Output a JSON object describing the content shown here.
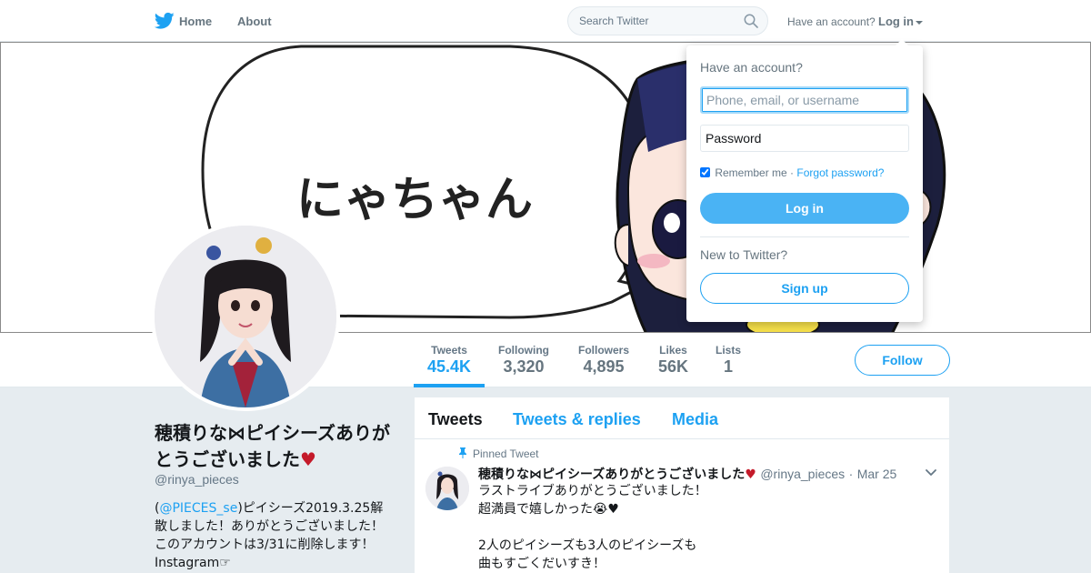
{
  "topnav": {
    "home_label": "Home",
    "about_label": "About",
    "search_placeholder": "Search Twitter",
    "have_account_text": "Have an account?",
    "login_label": "Log in"
  },
  "banner": {
    "speech_text": "にゃちゃん"
  },
  "profile_nav": {
    "stats": [
      {
        "label": "Tweets",
        "value": "45.4K"
      },
      {
        "label": "Following",
        "value": "3,320"
      },
      {
        "label": "Followers",
        "value": "4,895"
      },
      {
        "label": "Likes",
        "value": "56K"
      },
      {
        "label": "Lists",
        "value": "1"
      }
    ],
    "active_stat": "Tweets",
    "follow_label": "Follow"
  },
  "profile": {
    "name": "穂積りな⋈ピイシーズありがとうございました",
    "heart": "♥",
    "handle": "@rinya_pieces",
    "bio_prefix": "(",
    "bio_mention": "@PIECES_se",
    "bio_rest": ")ピイシーズ2019.3.25解散しました！ありがとうございました！このアカウントは3/31に削除します！ Instagram☞"
  },
  "timeline": {
    "tabs": [
      "Tweets",
      "Tweets & replies",
      "Media"
    ],
    "active_tab": "Tweets",
    "pinned_label": "Pinned Tweet",
    "tweet": {
      "name": "穂積りな⋈ピイシーズありがとうございました",
      "heart": "♥",
      "handle": "@rinya_pieces",
      "date_sep": "·",
      "date": "Mar 25",
      "lines": [
        "ラストライブありがとうございました！",
        "超満員で嬉しかった😭♥",
        "",
        "2人のピイシーズも3人のピイシーズも",
        "曲もすごくだいすき！"
      ]
    }
  },
  "login_dropdown": {
    "title": "Have an account?",
    "username_placeholder": "Phone, email, or username",
    "password_placeholder": "Password",
    "remember_label": "Remember me",
    "remember_sep": "·",
    "forgot_label": "Forgot password?",
    "login_button": "Log in",
    "new_to_twitter": "New to Twitter?",
    "signup_button": "Sign up"
  },
  "colors": {
    "brand_blue": "#1da1f2",
    "login_button_bg": "#4ab3f4",
    "heart_red": "#c41a2a",
    "page_bg": "#e6ecf0"
  }
}
